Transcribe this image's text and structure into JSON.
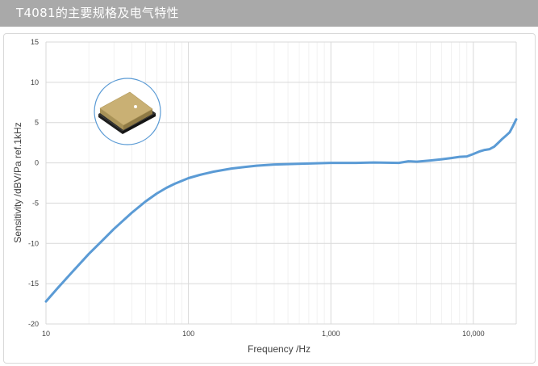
{
  "header": {
    "title": "T4081的主要规格及电气特性"
  },
  "colors": {
    "header_bg": "#a9a9a9",
    "curve": "#5b9bd5",
    "grid_major": "#d9d9d9",
    "grid_minor": "#eeeeee",
    "product_icon": "product-microphone-image"
  },
  "chart_data": {
    "type": "line",
    "title": "",
    "xlabel": "Frequency /Hz",
    "ylabel": "Sensitivity /dBV/Pa   ref.1kHz",
    "x_scale": "log",
    "xlim": [
      10,
      20000
    ],
    "ylim": [
      -20,
      15
    ],
    "x_ticks": [
      10,
      100,
      1000,
      10000
    ],
    "x_tick_labels": [
      "10",
      "100",
      "1,000",
      "10,000"
    ],
    "y_ticks": [
      15,
      10,
      5,
      0,
      -5,
      -10,
      -15,
      -20
    ],
    "y_tick_labels": [
      "15",
      "10",
      "5",
      "0",
      "-5",
      "-10",
      "-15",
      "-20"
    ],
    "grid": true,
    "series": [
      {
        "x": [
          10,
          12,
          15,
          20,
          25,
          30,
          40,
          50,
          60,
          70,
          80,
          100,
          120,
          150,
          200,
          250,
          300,
          400,
          500,
          700,
          1000,
          1500,
          2000,
          3000,
          3500,
          4000,
          5000,
          6000,
          7000,
          8000,
          9000,
          10000,
          11000,
          12000,
          13000,
          14000,
          15000,
          16000,
          17000,
          18000,
          19000,
          20000
        ],
        "y": [
          -17.2,
          -15.6,
          -13.7,
          -11.3,
          -9.6,
          -8.2,
          -6.2,
          -4.8,
          -3.8,
          -3.1,
          -2.6,
          -1.9,
          -1.5,
          -1.1,
          -0.7,
          -0.5,
          -0.35,
          -0.2,
          -0.15,
          -0.08,
          0.0,
          0.0,
          0.05,
          0.0,
          0.2,
          0.15,
          0.3,
          0.45,
          0.6,
          0.75,
          0.8,
          1.1,
          1.4,
          1.6,
          1.7,
          2.0,
          2.5,
          3.0,
          3.4,
          3.8,
          4.6,
          5.4
        ]
      }
    ]
  }
}
